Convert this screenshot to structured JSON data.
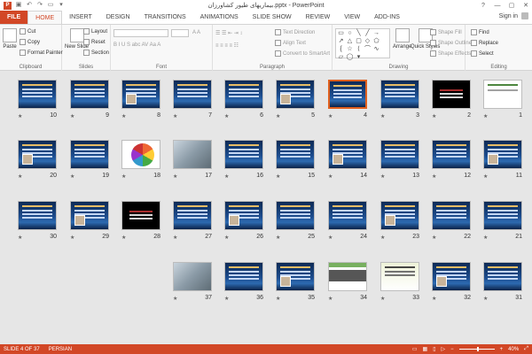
{
  "window": {
    "title": "بیماریهای طیور کشاورزان.pptx - PowerPoint",
    "controls": [
      "?",
      "—",
      "▢",
      "✕"
    ]
  },
  "tabs": [
    "FILE",
    "HOME",
    "INSERT",
    "DESIGN",
    "TRANSITIONS",
    "ANIMATIONS",
    "SLIDE SHOW",
    "REVIEW",
    "VIEW",
    "ADD-INS"
  ],
  "active_tab": "HOME",
  "signin": "Sign in",
  "ribbon": {
    "clipboard": {
      "label": "Clipboard",
      "paste": "Paste",
      "cut": "Cut",
      "copy": "Copy",
      "format_painter": "Format Painter"
    },
    "slides": {
      "label": "Slides",
      "new_slide": "New Slide",
      "layout": "Layout",
      "reset": "Reset",
      "section": "Section"
    },
    "font": {
      "label": "Font"
    },
    "paragraph": {
      "label": "Paragraph",
      "text_direction": "Text Direction",
      "align_text": "Align Text",
      "convert_smartart": "Convert to SmartArt"
    },
    "drawing": {
      "label": "Drawing",
      "arrange": "Arrange",
      "quick_styles": "Quick Styles",
      "shape_fill": "Shape Fill",
      "shape_outline": "Shape Outline",
      "shape_effects": "Shape Effects"
    },
    "editing": {
      "label": "Editing",
      "find": "Find",
      "replace": "Replace",
      "select": "Select"
    }
  },
  "slides": [
    {
      "n": "1",
      "style": "white"
    },
    {
      "n": "2",
      "style": "black"
    },
    {
      "n": "3",
      "style": "blue"
    },
    {
      "n": "4",
      "style": "blue"
    },
    {
      "n": "5",
      "style": "blue"
    },
    {
      "n": "6",
      "style": "blue"
    },
    {
      "n": "7",
      "style": "blue"
    },
    {
      "n": "8",
      "style": "blue"
    },
    {
      "n": "9",
      "style": "blue"
    },
    {
      "n": "10",
      "style": "blue"
    },
    {
      "n": "11",
      "style": "blue"
    },
    {
      "n": "12",
      "style": "blue"
    },
    {
      "n": "13",
      "style": "blue"
    },
    {
      "n": "14",
      "style": "blue"
    },
    {
      "n": "15",
      "style": "blue"
    },
    {
      "n": "16",
      "style": "blue"
    },
    {
      "n": "17",
      "style": "photo"
    },
    {
      "n": "18",
      "style": "chart"
    },
    {
      "n": "19",
      "style": "blue"
    },
    {
      "n": "20",
      "style": "blue"
    },
    {
      "n": "21",
      "style": "blue"
    },
    {
      "n": "22",
      "style": "blue"
    },
    {
      "n": "23",
      "style": "blue"
    },
    {
      "n": "24",
      "style": "blue"
    },
    {
      "n": "25",
      "style": "blue"
    },
    {
      "n": "26",
      "style": "blue"
    },
    {
      "n": "27",
      "style": "blue"
    },
    {
      "n": "28",
      "style": "black"
    },
    {
      "n": "29",
      "style": "blue"
    },
    {
      "n": "30",
      "style": "blue"
    },
    {
      "n": "31",
      "style": "blue"
    },
    {
      "n": "32",
      "style": "blue"
    },
    {
      "n": "33",
      "style": "light"
    },
    {
      "n": "34",
      "style": "green"
    },
    {
      "n": "35",
      "style": "blue"
    },
    {
      "n": "36",
      "style": "blue"
    },
    {
      "n": "37",
      "style": "photo"
    }
  ],
  "selected_slide": "4",
  "status": {
    "slide": "SLIDE 4 OF 37",
    "language": "PERSIAN",
    "zoom": "40%"
  }
}
